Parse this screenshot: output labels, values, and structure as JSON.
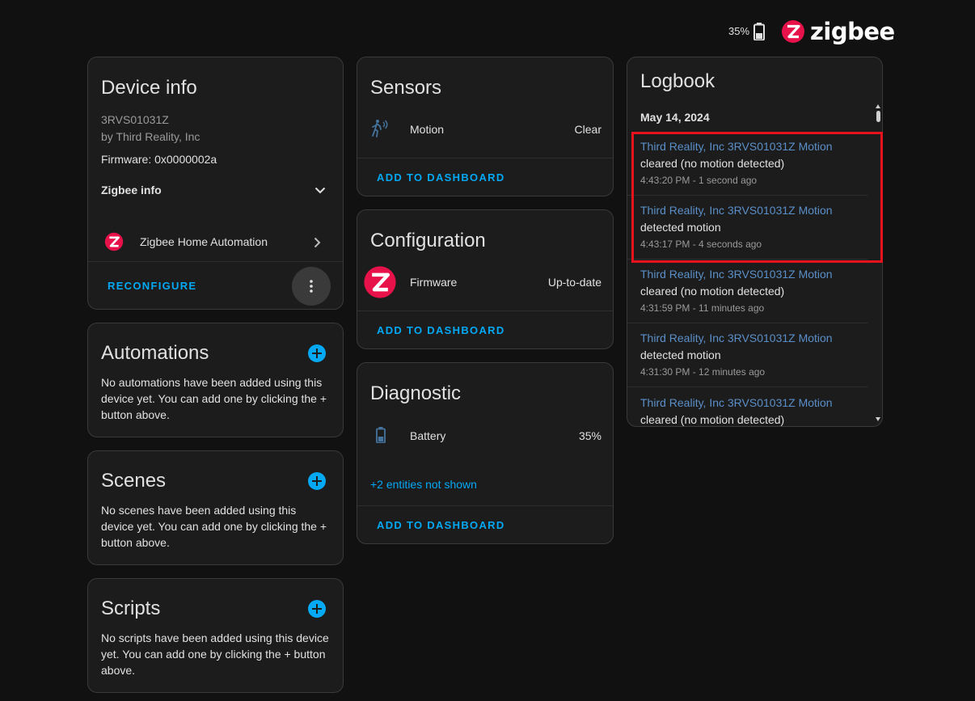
{
  "topbar": {
    "battery_pct": "35%",
    "logo_text": "zigbee"
  },
  "device_info": {
    "title": "Device info",
    "model": "3RVS01031Z",
    "manufacturer": "by Third Reality, Inc",
    "firmware": "Firmware: 0x0000002a",
    "zigbee_info_label": "Zigbee info",
    "integration_label": "Zigbee Home Automation",
    "reconfigure_label": "RECONFIGURE"
  },
  "automations": {
    "title": "Automations",
    "description": "No automations have been added using this device yet. You can add one by clicking the + button above."
  },
  "scenes": {
    "title": "Scenes",
    "description": "No scenes have been added using this device yet. You can add one by clicking the + button above."
  },
  "scripts": {
    "title": "Scripts",
    "description": "No scripts have been added using this device yet. You can add one by clicking the + button above."
  },
  "sensors": {
    "title": "Sensors",
    "entity_name": "Motion",
    "entity_state": "Clear",
    "add_label": "ADD TO DASHBOARD"
  },
  "configuration": {
    "title": "Configuration",
    "entity_name": "Firmware",
    "entity_state": "Up-to-date",
    "add_label": "ADD TO DASHBOARD"
  },
  "diagnostic": {
    "title": "Diagnostic",
    "entity_name": "Battery",
    "entity_state": "35%",
    "hidden_link": "+2 entities not shown",
    "add_label": "ADD TO DASHBOARD"
  },
  "logbook": {
    "title": "Logbook",
    "date": "May 14, 2024",
    "entries": [
      {
        "name": "Third Reality, Inc 3RVS01031Z Motion",
        "message": "cleared (no motion detected)",
        "time": "4:43:20 PM - 1 second ago"
      },
      {
        "name": "Third Reality, Inc 3RVS01031Z Motion",
        "message": "detected motion",
        "time": "4:43:17 PM - 4 seconds ago"
      },
      {
        "name": "Third Reality, Inc 3RVS01031Z Motion",
        "message": "cleared (no motion detected)",
        "time": "4:31:59 PM - 11 minutes ago"
      },
      {
        "name": "Third Reality, Inc 3RVS01031Z Motion",
        "message": "detected motion",
        "time": "4:31:30 PM - 12 minutes ago"
      },
      {
        "name": "Third Reality, Inc 3RVS01031Z Motion",
        "message": "cleared (no motion detected)",
        "time": ""
      }
    ]
  },
  "colors": {
    "accent": "#03a9f4",
    "logbook_link": "#5a8fc9",
    "zigbee_red": "#e8124a",
    "highlight": "#e8121e"
  }
}
